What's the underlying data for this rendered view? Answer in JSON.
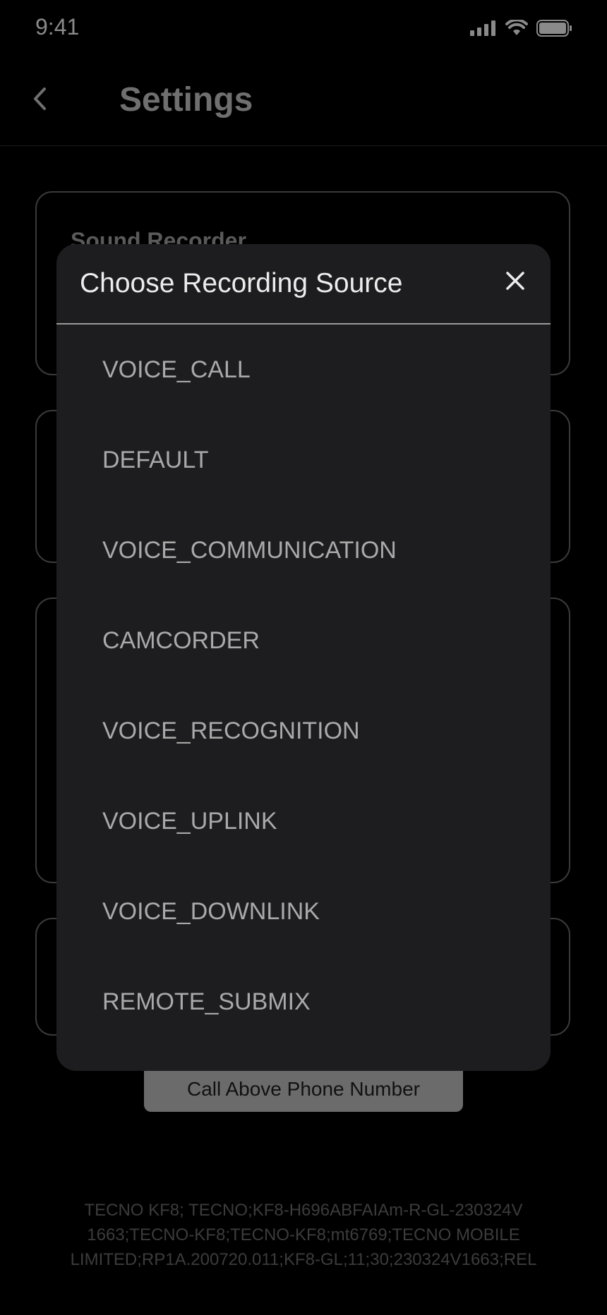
{
  "status_bar": {
    "time": "9:41",
    "icons": [
      "signal-icon",
      "wifi-icon",
      "battery-icon"
    ]
  },
  "header": {
    "back_icon": "chevron-left-icon",
    "title": "Settings"
  },
  "background": {
    "first_card_label": "Sound Recorder",
    "call_button_label": "Call Above Phone Number",
    "device_info": "TECNO KF8; TECNO;KF8-H696ABFAIAm-R-GL-230324V 1663;TECNO-KF8;TECNO-KF8;mt6769;TECNO MOBILE LIMITED;RP1A.200720.011;KF8-GL;11;30;230324V1663;REL"
  },
  "modal": {
    "title": "Choose Recording Source",
    "close_icon": "close-icon",
    "options": [
      "VOICE_CALL",
      "DEFAULT",
      "VOICE_COMMUNICATION",
      "CAMCORDER",
      "VOICE_RECOGNITION",
      "VOICE_UPLINK",
      "VOICE_DOWNLINK",
      "REMOTE_SUBMIX"
    ]
  },
  "colors": {
    "background": "#000000",
    "modal_background": "#1d1d1f",
    "modal_title": "#ececec",
    "option_text": "#a9a9a9",
    "divider": "#9a9a9a"
  }
}
